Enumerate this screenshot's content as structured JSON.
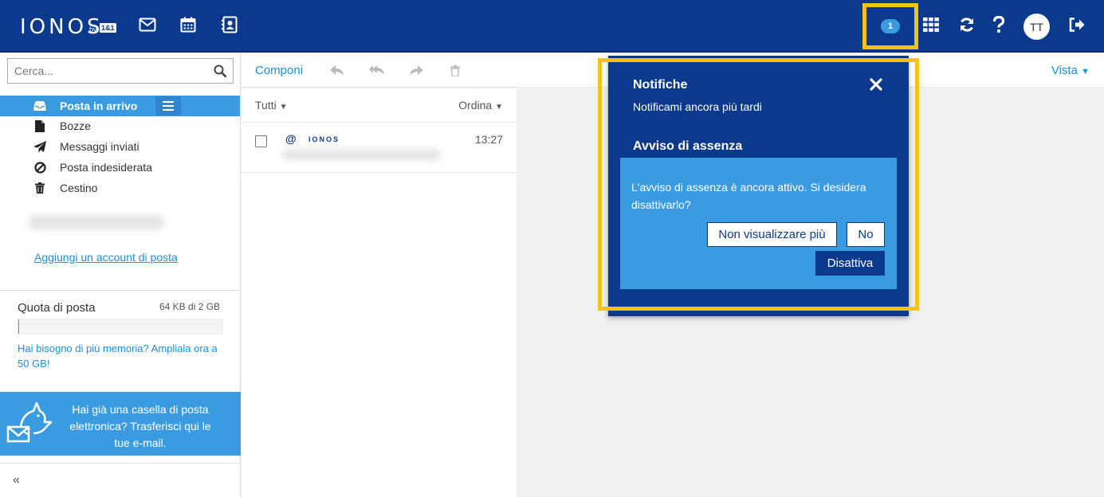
{
  "app": {
    "brand": "IONOS",
    "brand_by": "by",
    "brand_11": "1&1"
  },
  "header": {
    "notification_count": "1",
    "user_initials": "TT",
    "icons": [
      "mail-icon",
      "calendar-icon",
      "contacts-icon",
      "apps-grid-icon",
      "refresh-icon",
      "help-icon",
      "logout-icon"
    ]
  },
  "sidebar": {
    "search_placeholder": "Cerca...",
    "folders": [
      {
        "label": "Posta in arrivo",
        "icon": "inbox-icon",
        "active": true
      },
      {
        "label": "Bozze",
        "icon": "file-icon"
      },
      {
        "label": "Messaggi inviati",
        "icon": "paper-plane-icon"
      },
      {
        "label": "Posta indesiderata",
        "icon": "ban-icon"
      },
      {
        "label": "Cestino",
        "icon": "trash-icon"
      }
    ],
    "add_account": "Aggiungi un account di posta",
    "quota_title": "Quota di posta",
    "quota_value": "64 KB di 2 GB",
    "upgrade_text": "Hai bisogno di più memoria? Ampliala ora a 50 GB!",
    "promo_text": "Hai già una casella di posta elettronica? Trasferisci qui le tue e-mail.",
    "collapse": "«"
  },
  "toolbar": {
    "compose": "Componi",
    "view": "Vista"
  },
  "list": {
    "filter": "Tutti",
    "sort": "Ordina",
    "messages": [
      {
        "sender": "IONOS",
        "time": "13:27"
      }
    ]
  },
  "notification_panel": {
    "title": "Notifiche",
    "remind_later": "Notificami ancora più tardi",
    "subtitle": "Avviso di assenza",
    "message": "L'avviso di assenza è ancora attivo. Si desidera disattivarlo?",
    "btn_dont_show": "Non visualizzare più",
    "btn_no": "No",
    "btn_disable": "Disattiva"
  },
  "colors": {
    "brand_blue": "#0b3a8c",
    "accent_blue": "#3a9be0",
    "link_blue": "#1f8dd6",
    "highlight_yellow": "#f7c314"
  }
}
